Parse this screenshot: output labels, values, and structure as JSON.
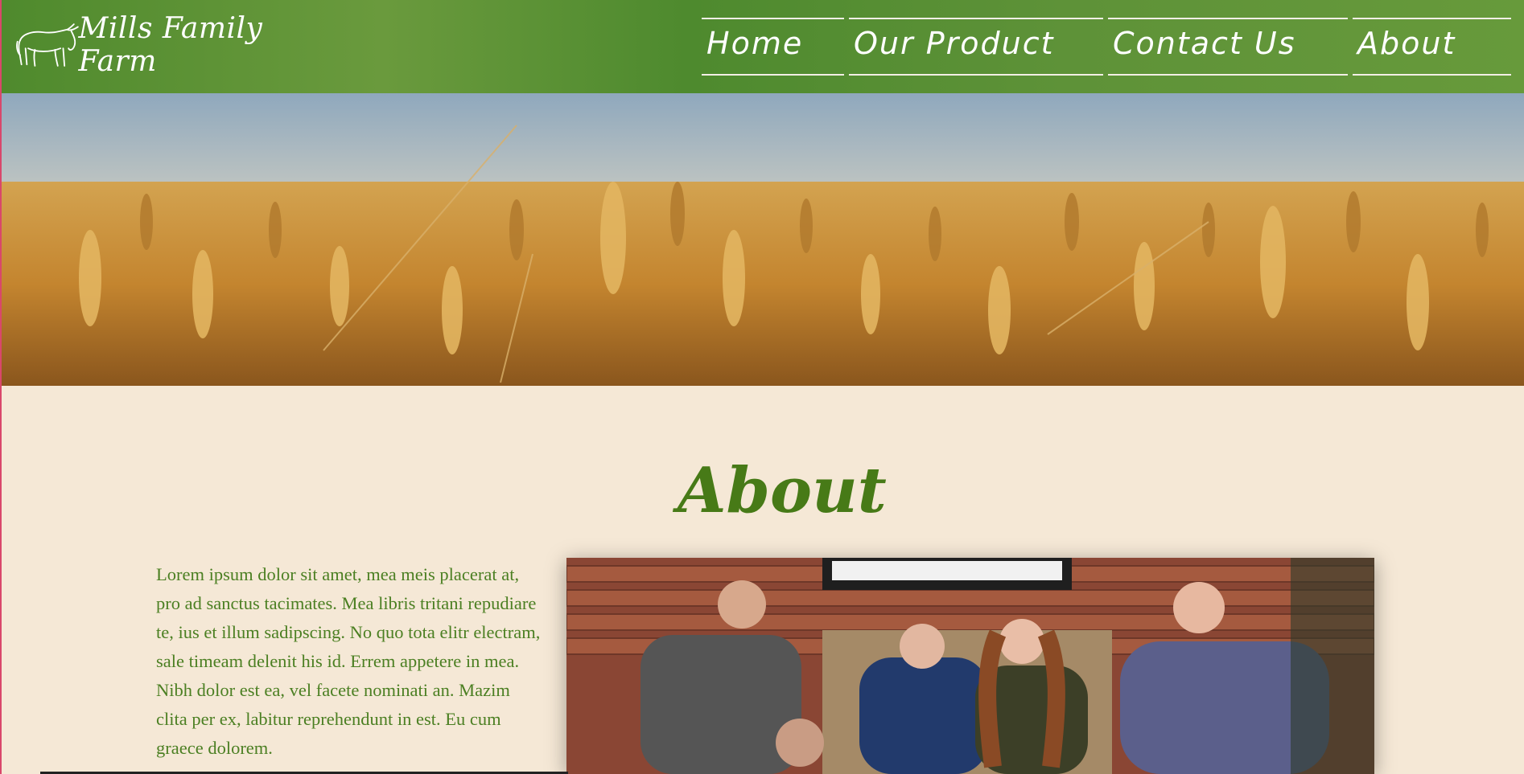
{
  "header": {
    "logo_text": "Mills Family Farm",
    "logo_icon": "cow-icon",
    "nav": [
      {
        "label": "Home"
      },
      {
        "label": "Our Product"
      },
      {
        "label": "Contact Us"
      },
      {
        "label": "About"
      }
    ],
    "colors": {
      "header_bg": "#5a8f33",
      "nav_text": "#ffffff"
    }
  },
  "hero": {
    "image": "wheat-field-photo"
  },
  "main": {
    "title": "About",
    "body_text": "Lorem ipsum dolor sit amet, mea meis placerat at, pro ad sanctus tacimates. Mea libris tritani repudiare te, ius et illum sadipscing. No quo tota elitr electram, sale timeam delenit his id. Errem appetere in mea. Nibh dolor est ea, vel facete nominati an. Mazim clita per ex, labitur reprehendunt in est. Eu cum graece dolorem.",
    "photo": "family-group-photo",
    "colors": {
      "title": "#477a17",
      "text": "#4b7f22",
      "page_bg": "#f5e8d6"
    }
  }
}
